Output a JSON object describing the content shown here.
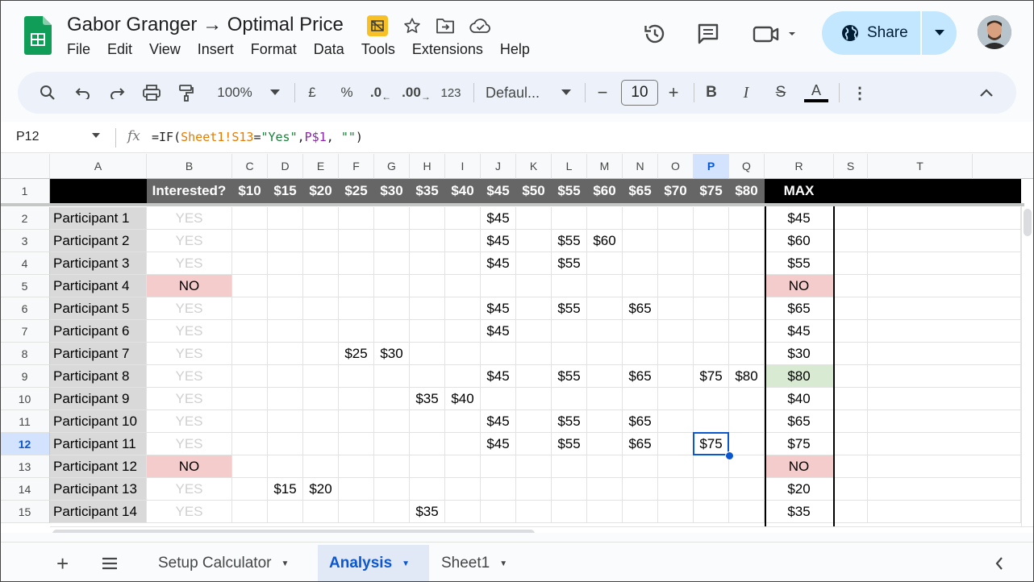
{
  "app": {
    "title": "Gabor Granger → Optimal Price",
    "menu": [
      "File",
      "Edit",
      "View",
      "Insert",
      "Format",
      "Data",
      "Tools",
      "Extensions",
      "Help"
    ],
    "share_label": "Share",
    "accent": "#0b57d0",
    "share_bg": "#c2e7ff"
  },
  "toolbar": {
    "zoom": "100%",
    "currency": "£",
    "percent": "%",
    "dec_less": ".0",
    "dec_more": ".00",
    "number_format": "123",
    "font": "Defaul...",
    "font_size": "10",
    "minus": "−",
    "plus": "+",
    "bold": "B",
    "italic": "I",
    "strike": "S",
    "text_color": "A",
    "more": "⋮"
  },
  "formula_bar": {
    "cell_ref": "P12",
    "fx": "fx",
    "formula_parts": [
      "=IF(",
      "Sheet1!S13",
      "=",
      "\"Yes\"",
      ",",
      "P$1",
      ", ",
      "\"\"",
      ")"
    ]
  },
  "grid": {
    "columns": [
      "A",
      "B",
      "C",
      "D",
      "E",
      "F",
      "G",
      "H",
      "I",
      "J",
      "K",
      "L",
      "M",
      "N",
      "O",
      "P",
      "Q",
      "R",
      "S",
      "T"
    ],
    "active_column": "P",
    "active_row": "12",
    "header_row": {
      "row": "1",
      "interested": "Interested?",
      "prices": [
        "$10",
        "$15",
        "$20",
        "$25",
        "$30",
        "$35",
        "$40",
        "$45",
        "$50",
        "$55",
        "$60",
        "$65",
        "$70",
        "$75",
        "$80"
      ],
      "max": "MAX"
    },
    "rows": [
      {
        "row": "2",
        "name": "Participant 1",
        "interested": "YES",
        "prices": [
          "",
          "",
          "",
          "",
          "",
          "",
          "",
          "$45",
          "",
          "",
          "",
          "",
          "",
          "",
          ""
        ],
        "max": "$45"
      },
      {
        "row": "3",
        "name": "Participant 2",
        "interested": "YES",
        "prices": [
          "",
          "",
          "",
          "",
          "",
          "",
          "",
          "$45",
          "",
          "$55",
          "$60",
          "",
          "",
          "",
          ""
        ],
        "max": "$60"
      },
      {
        "row": "4",
        "name": "Participant 3",
        "interested": "YES",
        "prices": [
          "",
          "",
          "",
          "",
          "",
          "",
          "",
          "$45",
          "",
          "$55",
          "",
          "",
          "",
          "",
          ""
        ],
        "max": "$55"
      },
      {
        "row": "5",
        "name": "Participant 4",
        "interested": "NO",
        "prices": [
          "",
          "",
          "",
          "",
          "",
          "",
          "",
          "",
          "",
          "",
          "",
          "",
          "",
          "",
          ""
        ],
        "max": "NO"
      },
      {
        "row": "6",
        "name": "Participant 5",
        "interested": "YES",
        "prices": [
          "",
          "",
          "",
          "",
          "",
          "",
          "",
          "$45",
          "",
          "$55",
          "",
          "$65",
          "",
          "",
          ""
        ],
        "max": "$65"
      },
      {
        "row": "7",
        "name": "Participant 6",
        "interested": "YES",
        "prices": [
          "",
          "",
          "",
          "",
          "",
          "",
          "",
          "$45",
          "",
          "",
          "",
          "",
          "",
          "",
          ""
        ],
        "max": "$45"
      },
      {
        "row": "8",
        "name": "Participant 7",
        "interested": "YES",
        "prices": [
          "",
          "",
          "",
          "$25",
          "$30",
          "",
          "",
          "",
          "",
          "",
          "",
          "",
          "",
          "",
          ""
        ],
        "max": "$30"
      },
      {
        "row": "9",
        "name": "Participant 8",
        "interested": "YES",
        "prices": [
          "",
          "",
          "",
          "",
          "",
          "",
          "",
          "$45",
          "",
          "$55",
          "",
          "$65",
          "",
          "$75",
          "$80"
        ],
        "max": "$80"
      },
      {
        "row": "10",
        "name": "Participant 9",
        "interested": "YES",
        "prices": [
          "",
          "",
          "",
          "",
          "",
          "$35",
          "$40",
          "",
          "",
          "",
          "",
          "",
          "",
          "",
          ""
        ],
        "max": "$40"
      },
      {
        "row": "11",
        "name": "Participant 10",
        "interested": "YES",
        "prices": [
          "",
          "",
          "",
          "",
          "",
          "",
          "",
          "$45",
          "",
          "$55",
          "",
          "$65",
          "",
          "",
          ""
        ],
        "max": "$65"
      },
      {
        "row": "12",
        "name": "Participant 11",
        "interested": "YES",
        "prices": [
          "",
          "",
          "",
          "",
          "",
          "",
          "",
          "$45",
          "",
          "$55",
          "",
          "$65",
          "",
          "$75",
          ""
        ],
        "max": "$75"
      },
      {
        "row": "13",
        "name": "Participant 12",
        "interested": "NO",
        "prices": [
          "",
          "",
          "",
          "",
          "",
          "",
          "",
          "",
          "",
          "",
          "",
          "",
          "",
          "",
          ""
        ],
        "max": "NO"
      },
      {
        "row": "14",
        "name": "Participant 13",
        "interested": "YES",
        "prices": [
          "",
          "$15",
          "$20",
          "",
          "",
          "",
          "",
          "",
          "",
          "",
          "",
          "",
          "",
          "",
          ""
        ],
        "max": "$20"
      },
      {
        "row": "15",
        "name": "Participant 14",
        "interested": "YES",
        "prices": [
          "",
          "",
          "",
          "",
          "",
          "$35",
          "",
          "",
          "",
          "",
          "",
          "",
          "",
          "",
          ""
        ],
        "max": "$35"
      }
    ]
  },
  "sheets": {
    "tabs": [
      "Setup Calculator",
      "Analysis",
      "Sheet1"
    ],
    "active": "Analysis"
  }
}
